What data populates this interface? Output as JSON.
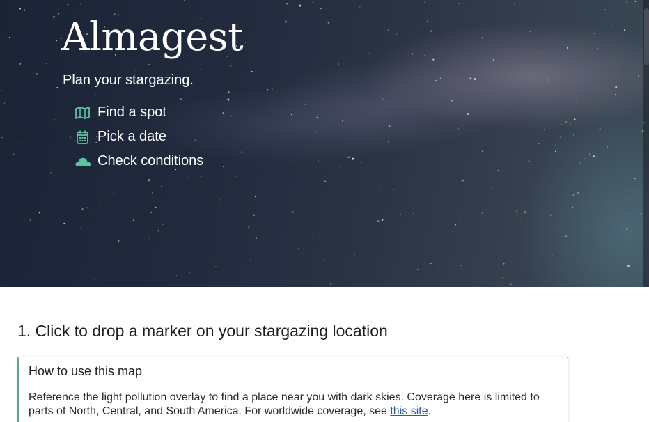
{
  "hero": {
    "brand": "Almagest",
    "tagline": "Plan your stargazing.",
    "features": [
      {
        "label": "Find a spot",
        "icon": "map-icon"
      },
      {
        "label": "Pick a date",
        "icon": "calendar-icon"
      },
      {
        "label": "Check conditions",
        "icon": "cloud-icon"
      }
    ]
  },
  "main": {
    "step_heading": "1. Click to drop a marker on your stargazing location",
    "info": {
      "title": "How to use this map",
      "text_before_link": "Reference the light pollution overlay to find a place near you with dark skies. Coverage here is limited to parts of North, Central, and South America. For worldwide coverage, see ",
      "link_text": "this site",
      "text_after_link": "."
    }
  },
  "colors": {
    "accent": "#5fc1a1",
    "info_border": "#5fa58c",
    "link": "#2a5d99",
    "hero_bg": "#1f2638"
  }
}
